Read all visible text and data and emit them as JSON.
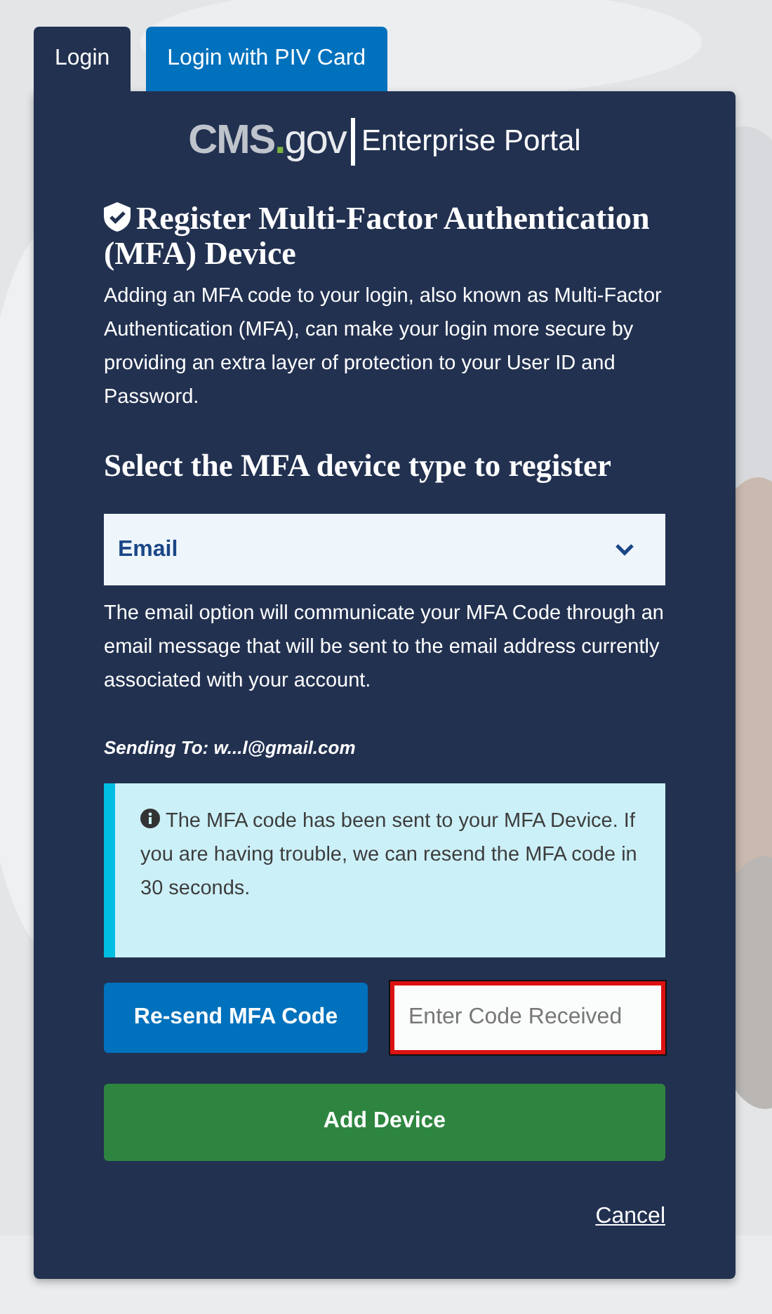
{
  "tabs": [
    {
      "label": "Login",
      "selected": true
    },
    {
      "label": "Login with PIV Card",
      "selected": false
    }
  ],
  "logo": {
    "brand": "CMS",
    "dot": ".",
    "domain": "gov",
    "product": "Enterprise Portal"
  },
  "title": "Register Multi-Factor Authentication (MFA) Device",
  "intro": "Adding an MFA code to your login, also known as Multi-Factor Authentication (MFA), can make your login more secure by providing an extra layer of protection to your User ID and Password.",
  "device_heading": "Select the MFA device type to register",
  "device_select": {
    "value": "Email"
  },
  "device_description": "The email option will communicate your MFA Code through an email message that will be sent to the email address currently associated with your account.",
  "sending_to": "Sending To: w...l@gmail.com",
  "alert": "The MFA code has been sent to your MFA Device. If you are having trouble, we can resend the MFA code in 30 seconds.",
  "resend_button": "Re-send MFA Code",
  "code_field": {
    "placeholder": "Enter Code Received",
    "invalid": true
  },
  "add_button": "Add Device",
  "cancel_link": "Cancel"
}
